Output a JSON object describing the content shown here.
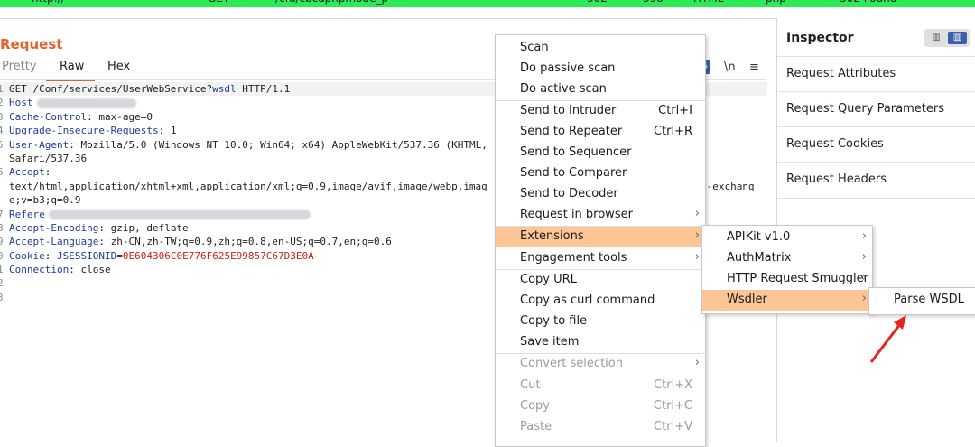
{
  "top_bar": {
    "fragments": [
      "http://",
      "GET",
      "/cfu/cbcaphpmode_p",
      "302",
      "398",
      "HTML",
      "php",
      "302 Found"
    ]
  },
  "request": {
    "title": "Request",
    "tabs": [
      "Pretty",
      "Raw",
      "Hex"
    ],
    "tools": {
      "badge": "5",
      "newline": "\\n",
      "menu": "≡"
    },
    "lines": [
      {
        "n": "1",
        "parts": [
          {
            "t": "GET /Conf/services/UserWebService?",
            "c": "plain"
          },
          {
            "t": "wsdl",
            "c": "key"
          },
          {
            "t": " HTTP/1.1",
            "c": "plain"
          }
        ]
      },
      {
        "n": "2",
        "parts": [
          {
            "t": "Host",
            "c": "key"
          }
        ],
        "blur": 110
      },
      {
        "n": "3",
        "parts": [
          {
            "t": "Cache-Control",
            "c": "key"
          },
          {
            "t": ": max-age=0",
            "c": "plain"
          }
        ]
      },
      {
        "n": "4",
        "parts": [
          {
            "t": "Upgrade-Insecure-Requests",
            "c": "key"
          },
          {
            "t": ": 1",
            "c": "plain"
          }
        ]
      },
      {
        "n": "5",
        "parts": [
          {
            "t": "User-Agent",
            "c": "key"
          },
          {
            "t": ": Mozilla/5.0 (Windows NT 10.0; Win64; x64) AppleWebKit/537.36 (KHTML,",
            "c": "plain"
          }
        ]
      },
      {
        "n": "",
        "parts": [
          {
            "t": "Safari/537.36",
            "c": "plain"
          }
        ]
      },
      {
        "n": "6",
        "parts": [
          {
            "t": "Accept",
            "c": "key"
          },
          {
            "t": ":",
            "c": "plain"
          }
        ]
      },
      {
        "n": "",
        "parts": [
          {
            "t": "text/html,application/xhtml+xml,application/xml;q=0.9,image/avif,image/webp,imag",
            "c": "plain"
          }
        ],
        "tail": "d-exchang"
      },
      {
        "n": "",
        "parts": [
          {
            "t": "e;v=b3;q=0.9",
            "c": "plain"
          }
        ]
      },
      {
        "n": "7",
        "parts": [
          {
            "t": "Refere",
            "c": "key"
          }
        ],
        "blur": 290
      },
      {
        "n": "8",
        "parts": [
          {
            "t": "Accept-Encoding",
            "c": "key"
          },
          {
            "t": ": gzip, deflate",
            "c": "plain"
          }
        ]
      },
      {
        "n": "9",
        "parts": [
          {
            "t": "Accept-Language",
            "c": "key"
          },
          {
            "t": ": zh-CN,zh-TW;q=0.9,zh;q=0.8,en-US;q=0.7,en;q=0.6",
            "c": "plain"
          }
        ]
      },
      {
        "n": "0",
        "parts": [
          {
            "t": "Cookie",
            "c": "key"
          },
          {
            "t": ": ",
            "c": "plain"
          },
          {
            "t": "JSESSIONID",
            "c": "key"
          },
          {
            "t": "=",
            "c": "plain"
          },
          {
            "t": "0E604306C0E776F625E99857C67D3E0A",
            "c": "cval"
          }
        ]
      },
      {
        "n": "1",
        "parts": [
          {
            "t": "Connection",
            "c": "key"
          },
          {
            "t": ": close",
            "c": "plain"
          }
        ]
      },
      {
        "n": "2",
        "parts": []
      },
      {
        "n": "3",
        "parts": []
      }
    ]
  },
  "inspector": {
    "title": "Inspector",
    "items": [
      "Request Attributes",
      "Request Query Parameters",
      "Request Cookies",
      "Request Headers"
    ]
  },
  "context_menu": {
    "items": [
      {
        "label": "Scan",
        "shortcut": "",
        "submenu": false,
        "state": "normal"
      },
      {
        "label": "Do passive scan",
        "shortcut": "",
        "submenu": false,
        "state": "normal"
      },
      {
        "label": "Do active scan",
        "shortcut": "",
        "submenu": false,
        "state": "normal"
      },
      {
        "label": "Send to Intruder",
        "shortcut": "Ctrl+I",
        "submenu": false,
        "state": "normal"
      },
      {
        "label": "Send to Repeater",
        "shortcut": "Ctrl+R",
        "submenu": false,
        "state": "normal"
      },
      {
        "label": "Send to Sequencer",
        "shortcut": "",
        "submenu": false,
        "state": "normal"
      },
      {
        "label": "Send to Comparer",
        "shortcut": "",
        "submenu": false,
        "state": "normal"
      },
      {
        "label": "Send to Decoder",
        "shortcut": "",
        "submenu": false,
        "state": "normal"
      },
      {
        "label": "Request in browser",
        "shortcut": "",
        "submenu": true,
        "state": "normal"
      },
      {
        "label": "Extensions",
        "shortcut": "",
        "submenu": true,
        "state": "selected"
      },
      {
        "label": "Engagement tools",
        "shortcut": "",
        "submenu": true,
        "state": "normal"
      },
      {
        "label": "Copy URL",
        "shortcut": "",
        "submenu": false,
        "state": "normal"
      },
      {
        "label": "Copy as curl command",
        "shortcut": "",
        "submenu": false,
        "state": "normal"
      },
      {
        "label": "Copy to file",
        "shortcut": "",
        "submenu": false,
        "state": "normal"
      },
      {
        "label": "Save item",
        "shortcut": "",
        "submenu": false,
        "state": "normal"
      },
      {
        "label": "Convert selection",
        "shortcut": "",
        "submenu": true,
        "state": "disabled"
      },
      {
        "label": "Cut",
        "shortcut": "Ctrl+X",
        "submenu": false,
        "state": "disabled"
      },
      {
        "label": "Copy",
        "shortcut": "Ctrl+C",
        "submenu": false,
        "state": "disabled"
      },
      {
        "label": "Paste",
        "shortcut": "Ctrl+V",
        "submenu": false,
        "state": "disabled"
      }
    ]
  },
  "extensions_menu": {
    "items": [
      {
        "label": "APIKit v1.0",
        "submenu": true,
        "state": "normal"
      },
      {
        "label": "AuthMatrix",
        "submenu": true,
        "state": "normal"
      },
      {
        "label": "HTTP Request Smuggler",
        "submenu": true,
        "state": "normal"
      },
      {
        "label": "Wsdler",
        "submenu": true,
        "state": "selected"
      }
    ]
  },
  "wsdler_menu": {
    "items": [
      {
        "label": "Parse WSDL"
      }
    ]
  },
  "colors": {
    "accent": "#e8602c",
    "selection": "#fbc596",
    "annotation_arrow": "#e8241c",
    "header_key": "#1f3d99",
    "cookie_value": "#c4221c"
  }
}
